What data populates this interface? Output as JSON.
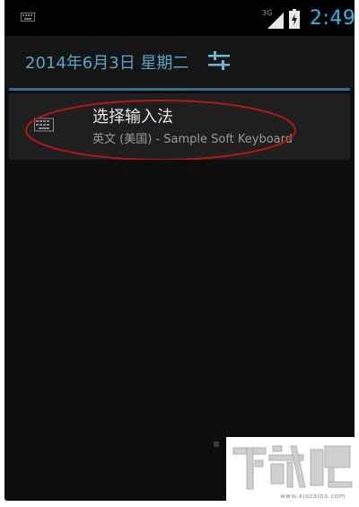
{
  "status_bar": {
    "time": "2:49",
    "network": "3G",
    "icons": [
      "keyboard-icon",
      "signal-icon",
      "battery-icon"
    ]
  },
  "header": {
    "date": "2014年6月3日 星期二",
    "settings_icon": "settings-icon"
  },
  "notification": {
    "title": "选择输入法",
    "subtitle": "英文 (美国) - Sample Soft Keyboard",
    "icon": "keyboard-icon"
  },
  "watermark": {
    "logo_text": "下载吧",
    "url": "www.xiazaiba.com"
  },
  "colors": {
    "accent": "#33b5e5",
    "highlight": "#b01818",
    "background": "#0d0d0d"
  }
}
